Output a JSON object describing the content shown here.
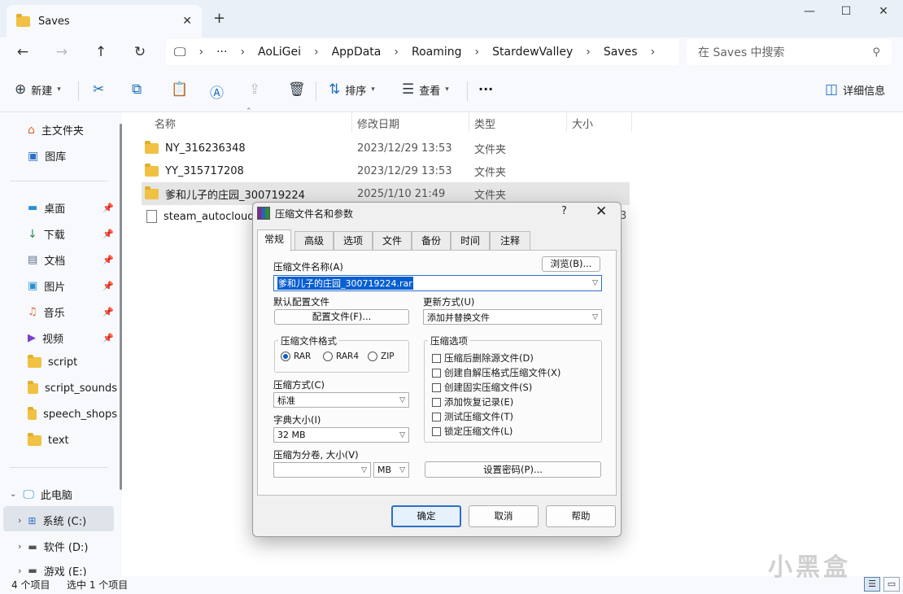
{
  "window": {
    "tab_title": "Saves",
    "minimize": "—",
    "maximize": "☐",
    "close": "✕"
  },
  "address": {
    "breadcrumbs": [
      "AoLiGei",
      "AppData",
      "Roaming",
      "StardewValley",
      "Saves"
    ],
    "ellipsis": "···",
    "search_placeholder": "在 Saves 中搜索"
  },
  "toolbar": {
    "new_label": "新建",
    "sort_label": "排序",
    "view_label": "查看",
    "more_label": "···",
    "details_label": "详细信息"
  },
  "sidebar": {
    "quick": [
      {
        "label": "主文件夹",
        "icon": "home-icon"
      },
      {
        "label": "图库",
        "icon": "gallery-icon"
      }
    ],
    "pinned": [
      {
        "label": "桌面",
        "icon": "desktop-icon"
      },
      {
        "label": "下载",
        "icon": "download-icon"
      },
      {
        "label": "文档",
        "icon": "document-icon"
      },
      {
        "label": "图片",
        "icon": "picture-icon"
      },
      {
        "label": "音乐",
        "icon": "music-icon"
      },
      {
        "label": "视频",
        "icon": "video-icon"
      }
    ],
    "folders": [
      "script",
      "script_sounds",
      "speech_shops",
      "text"
    ],
    "this_pc": "此电脑",
    "drives": [
      "系统 (C:)",
      "软件 (D:)",
      "游戏 (E:)"
    ]
  },
  "files": {
    "columns": [
      "名称",
      "修改日期",
      "类型",
      "大小"
    ],
    "rows": [
      {
        "name": "NY_316236348",
        "date": "2023/12/29 13:53",
        "type": "文件夹"
      },
      {
        "name": "YY_315717208",
        "date": "2023/12/29 13:53",
        "type": "文件夹"
      },
      {
        "name": "爹和儿子的庄园_300719224",
        "date": "2025/1/10 21:49",
        "type": "文件夹"
      },
      {
        "name": "steam_autocloud.vd",
        "date": "",
        "type": ""
      }
    ],
    "partial_size_digit": "3"
  },
  "status": {
    "count": "4 个项目",
    "selected": "选中 1 个项目"
  },
  "watermark": "小黑盒",
  "dialog": {
    "title": "压缩文件名和参数",
    "help": "?",
    "close": "✕",
    "tabs": [
      "常规",
      "高级",
      "选项",
      "文件",
      "备份",
      "时间",
      "注释"
    ],
    "archive_name_label": "压缩文件名称(A)",
    "browse_button": "浏览(B)...",
    "archive_name_value": "爹和儿子的庄园_300719224.rar",
    "default_profile_label": "默认配置文件",
    "profile_button": "配置文件(F)...",
    "update_mode_label": "更新方式(U)",
    "update_mode_value": "添加并替换文件",
    "format_label": "压缩文件格式",
    "formats": [
      "RAR",
      "RAR4",
      "ZIP"
    ],
    "selected_format": "RAR",
    "options_label": "压缩选项",
    "options": [
      "压缩后删除源文件(D)",
      "创建自解压格式压缩文件(X)",
      "创建固实压缩文件(S)",
      "添加恢复记录(E)",
      "测试压缩文件(T)",
      "锁定压缩文件(L)"
    ],
    "method_label": "压缩方式(C)",
    "method_value": "标准",
    "dict_label": "字典大小(I)",
    "dict_value": "32 MB",
    "split_label": "压缩为分卷, 大小(V)",
    "split_value": "",
    "split_unit": "MB",
    "password_button": "设置密码(P)...",
    "ok": "确定",
    "cancel": "取消",
    "help_button": "帮助"
  }
}
